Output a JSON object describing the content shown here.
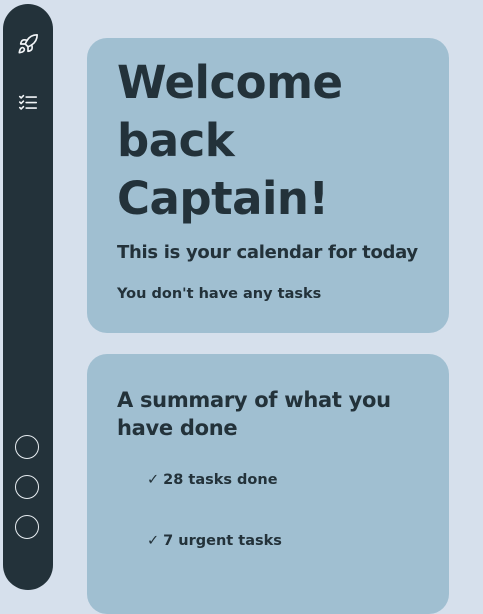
{
  "sidebar": {
    "items": [
      {
        "icon": "rocket-icon",
        "label": "Launch"
      },
      {
        "icon": "tasklist-icon",
        "label": "Tasks"
      }
    ],
    "circle_buttons": 3
  },
  "welcome": {
    "title": "Welcome back Captain!",
    "subtitle": "This is your calendar for today",
    "tasks_message": "You don't have any tasks"
  },
  "summary": {
    "title": "A summary of what you have done",
    "check_glyph": "✓",
    "items": [
      {
        "text": "28 tasks done"
      },
      {
        "text": "7 urgent tasks"
      }
    ]
  },
  "colors": {
    "background": "#d6e0ec",
    "sidebar": "#23323a",
    "card": "#a0bfd1",
    "text": "#23323a"
  }
}
